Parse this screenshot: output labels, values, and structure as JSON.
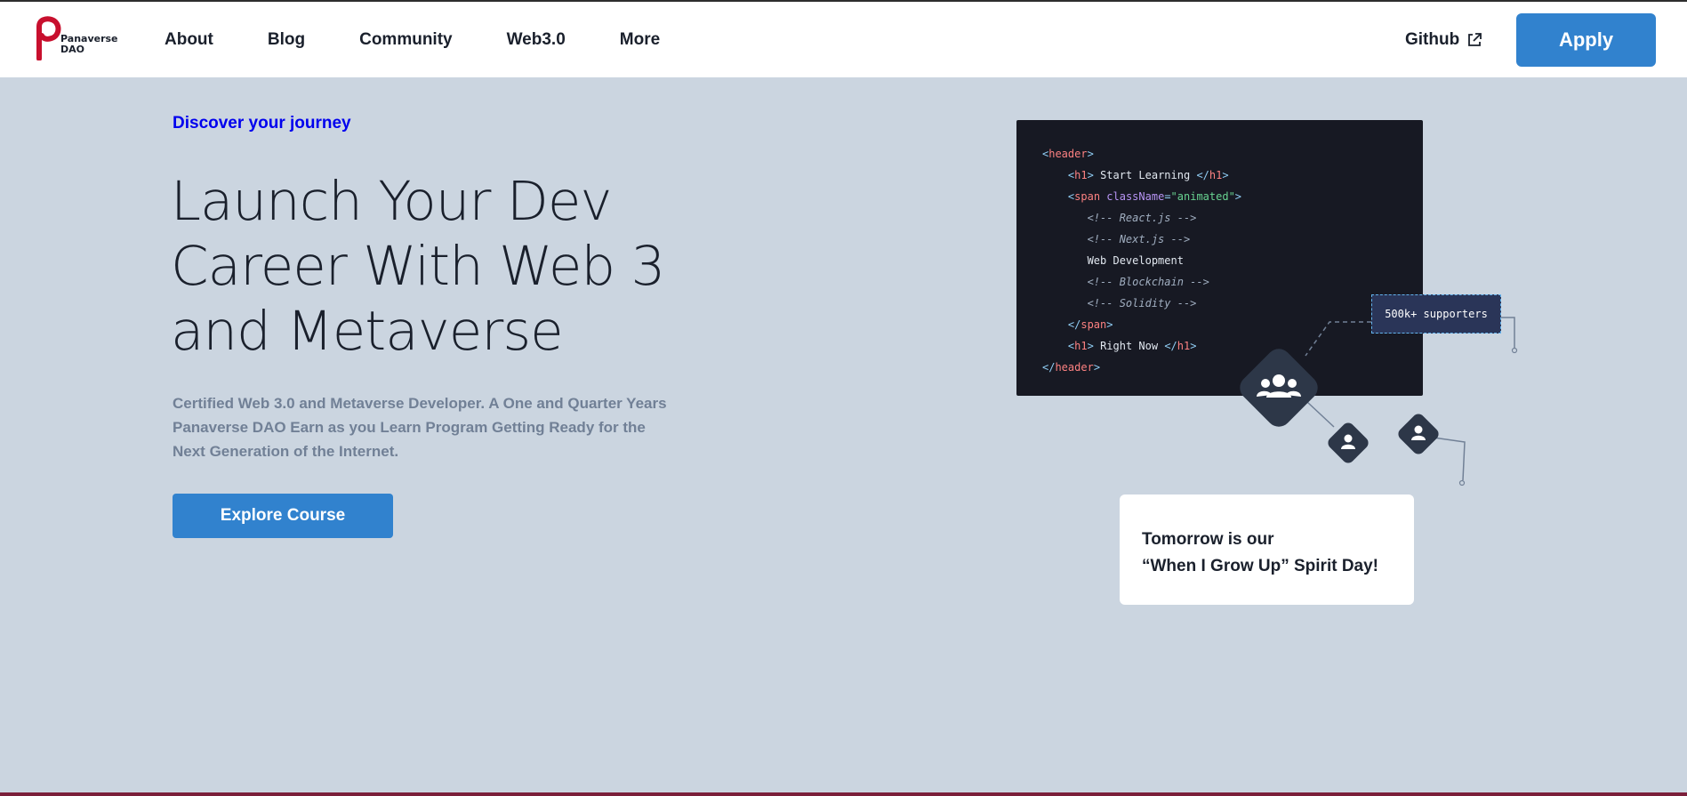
{
  "nav": {
    "logo_line1": "Panaverse",
    "logo_line2": "DAO",
    "links": [
      "About",
      "Blog",
      "Community",
      "Web3.0",
      "More"
    ],
    "github_label": "Github",
    "apply_label": "Apply"
  },
  "hero": {
    "eyebrow": "Discover your journey",
    "headline": "Launch Your Dev Career With Web 3 and Metaverse",
    "description": "Certified Web 3.0 and Metaverse Developer. A One and Quarter Years Panaverse DAO Earn as you Learn Program Getting Ready for the Next Generation of the Internet.",
    "cta_label": "Explore Course"
  },
  "illustration": {
    "code": {
      "header_open": "header",
      "h1_tag": "h1",
      "h1_text": "Start Learning",
      "span_tag": "span",
      "span_attr": "className",
      "span_value": "\"animated\"",
      "comment_react": "<!-- React.js -->",
      "comment_next": "<!-- Next.js -->",
      "web_dev": "Web Development",
      "comment_blockchain": "<!-- Blockchain -->",
      "comment_solidity": "<!-- Solidity -->",
      "h1_text2": "Right Now"
    },
    "supporters": "500k+ supporters",
    "spirit_line1": "Tomorrow is our",
    "spirit_line2": "“When I Grow Up” Spirit Day!"
  },
  "colors": {
    "accent": "#3182ce",
    "hero_bg": "#cbd5e0",
    "eyebrow": "#0000ee",
    "code_bg": "#171923"
  }
}
